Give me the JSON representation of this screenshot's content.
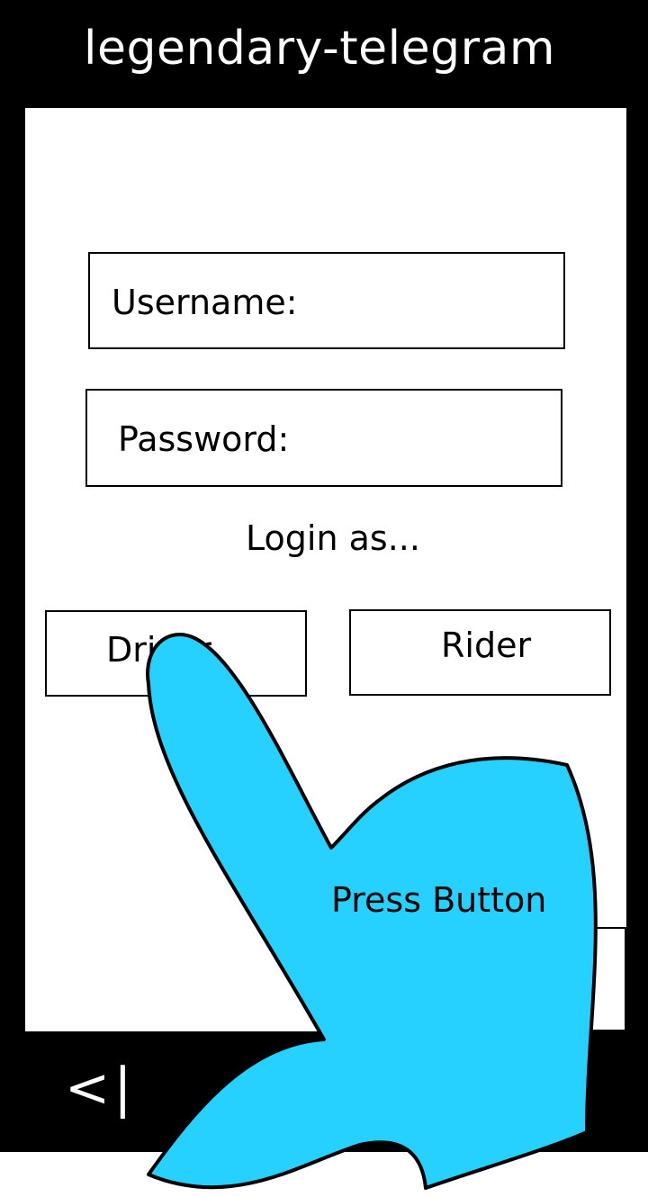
{
  "app": {
    "title": "legendary-telegram"
  },
  "login_form": {
    "username_label": "Username:",
    "password_label": "Password:",
    "login_as_text": "Login as..."
  },
  "role_buttons": {
    "driver_label": "Driver",
    "rider_label": "Rider"
  },
  "navigation": {
    "back_glyph": "<|"
  },
  "annotation": {
    "hand_label": "Press Button",
    "hand_color": "#26D1FF"
  },
  "colors": {
    "frame": "#000000",
    "screen": "#FFFFFF",
    "hand": "#26D1FF"
  }
}
